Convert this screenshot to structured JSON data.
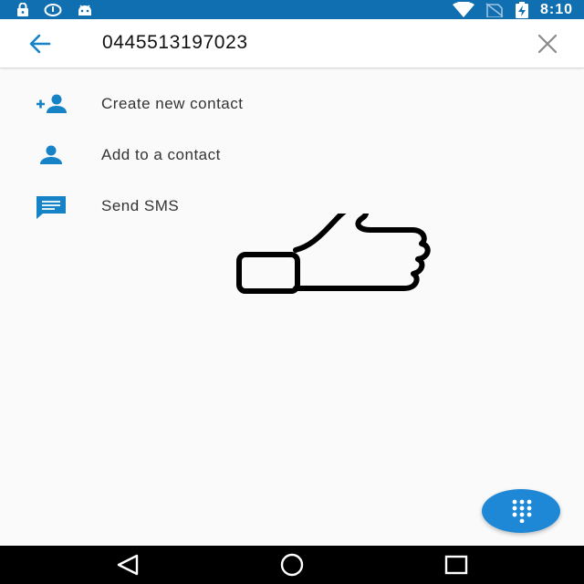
{
  "status_bar": {
    "time": "8:10",
    "left_icons": [
      "lock-icon",
      "sync-icon",
      "android-icon"
    ],
    "right_icons": [
      "wifi-icon",
      "no-sim-icon",
      "battery-charging-icon"
    ]
  },
  "search": {
    "query": "0445513197023",
    "back_icon": "arrow-back-icon",
    "clear_icon": "close-icon"
  },
  "actions": [
    {
      "icon": "person-add-icon",
      "label": "Create new contact"
    },
    {
      "icon": "person-icon",
      "label": "Add to a contact"
    },
    {
      "icon": "message-icon",
      "label": "Send SMS"
    }
  ],
  "overlay": {
    "icon": "thumbs-up-icon"
  },
  "fab": {
    "icon": "dialpad-icon"
  },
  "nav_bar": {
    "buttons": [
      "back-icon",
      "home-icon",
      "recents-icon"
    ]
  },
  "colors": {
    "status_bar": "#0f6fb0",
    "accent": "#1e88d6",
    "icon": "#1583c6",
    "background": "#fafafa",
    "nav_bar": "#000000"
  }
}
